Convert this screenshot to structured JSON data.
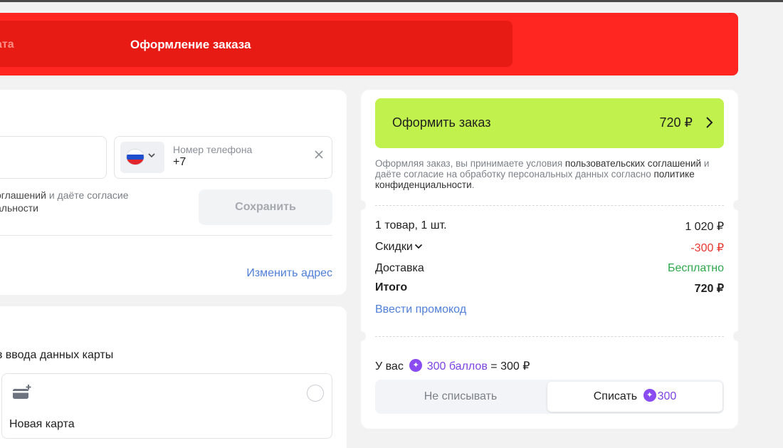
{
  "header": {
    "prev_step": "ата",
    "current_step": "Оформление заказа"
  },
  "contact": {
    "phone_label": "Номер телефона",
    "phone_value": "+7",
    "consent_line1_link": "оглашений",
    "consent_line1_rest": " и даёте согласие",
    "consent_line2": "альности",
    "save_label": "Сохранить",
    "change_address": "Изменить адрес"
  },
  "payment": {
    "hint": "з ввода данных карты",
    "new_card_label": "Новая карта"
  },
  "summary": {
    "checkout_label": "Оформить заказ",
    "checkout_price": "720 ₽",
    "terms_1": "Оформляя заказ, вы принимаете условия ",
    "terms_link_1": "пользовательских соглашений",
    "terms_2": " и даёте согласие на обработку персональных данных согласно ",
    "terms_link_2": "политике конфиденциальности",
    "terms_3": ".",
    "items_label": "1 товар, 1 шт.",
    "items_value": "1 020 ₽",
    "discount_label": "Скидки",
    "discount_value": "-300 ₽",
    "delivery_label": "Доставка",
    "delivery_value": "Бесплатно",
    "total_label": "Итого",
    "total_value": "720 ₽",
    "promo_label": "Ввести промокод",
    "bonus_prefix": "У вас",
    "bonus_points": "300 баллов",
    "bonus_suffix": "= 300 ₽",
    "seg_no_spend": "Не списывать",
    "seg_spend": "Списать",
    "seg_spend_amount": "300"
  },
  "colors": {
    "header_red": "#ff2521",
    "checkout_green": "#c1f14d",
    "link_blue": "#4f7fd8",
    "discount_red": "#e8372e",
    "free_green": "#2ea84b",
    "bonus_purple": "#7d42e3"
  },
  "icons": [
    "flag-ru-icon",
    "chevron-down-icon",
    "close-icon",
    "add-card-icon",
    "radio-icon",
    "chevron-right-icon",
    "bonus-coin-icon"
  ]
}
